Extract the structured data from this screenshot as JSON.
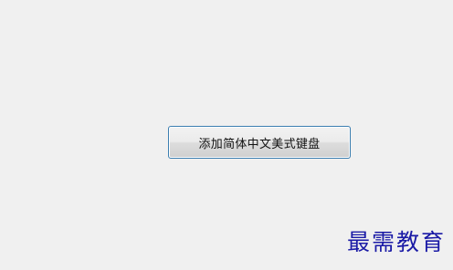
{
  "main": {
    "add_button_label": "添加简体中文美式键盘"
  },
  "watermark": {
    "text": "最需教育",
    "color": "#1a1aa6"
  },
  "colors": {
    "background": "#f0f0f0",
    "button_border": "#3c7fb1"
  }
}
